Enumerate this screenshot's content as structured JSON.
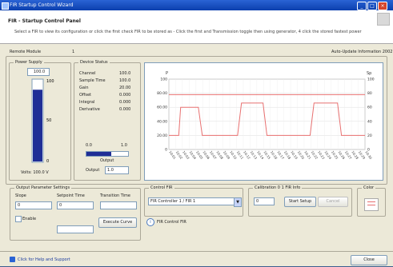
{
  "window": {
    "title": "FIR Startup Control Wizard"
  },
  "header": {
    "title": "FIR - Startup Control Panel",
    "subtitle": "Select a FIR to view its configuration or click the first check FIR to be stored as - Click the first and Transmission toggle then using generator, 4 click the stored fastest power"
  },
  "status": {
    "left_label": "Remote Module",
    "left_value": "1",
    "right_text": "Auto-Update Information 2002"
  },
  "power_supply": {
    "label": "Power Supply",
    "top_value": "100.0",
    "level": 0.88,
    "scale": [
      "100",
      "50",
      "0"
    ],
    "bottom_value": "Volts: 100.0 V"
  },
  "device_info": {
    "label": "Device Status",
    "rows": [
      {
        "name": "Channel",
        "value": "100.0"
      },
      {
        "name": "Sample Time",
        "value": "100.0"
      },
      {
        "name": "Gain",
        "value": "20.00"
      },
      {
        "name": "Offset",
        "value": "0.000"
      },
      {
        "name": "Integral",
        "value": "0.000"
      },
      {
        "name": "Derivative",
        "value": "0.000"
      }
    ],
    "range_min": "0.0",
    "range_max": "1.0",
    "slider_level": 0.6,
    "slider_caption": "Output",
    "output_label": "Output",
    "output_value": "1.0"
  },
  "chart_data": {
    "type": "line",
    "ylabel_left": "P",
    "ylabel_right": "Sp",
    "ylim": [
      0,
      100
    ],
    "y_ticks": [
      "100",
      "80.00",
      "60.00",
      "40.00",
      "20.00",
      "0"
    ],
    "y2_ticks": [
      "100",
      "80",
      "60",
      "40",
      "20",
      "0"
    ],
    "x_ticks": [
      "10:01",
      "10:02",
      "10:03",
      "10:04",
      "10:05",
      "10:06",
      "10:07",
      "10:08",
      "10:09",
      "10:10",
      "10:11",
      "10:12",
      "10:13",
      "10:14",
      "10:15",
      "10:16",
      "10:17",
      "10:18",
      "10:19",
      "10:20",
      "10:21",
      "10:22",
      "10:23",
      "10:24",
      "10:25",
      "10:26",
      "10:27",
      "10:28",
      "10:29",
      "10:30"
    ],
    "series": [
      {
        "color": "#e87070",
        "x": [
          0,
          1
        ],
        "y": [
          78,
          78
        ]
      },
      {
        "color": "#e87070",
        "x": [
          0,
          0.05,
          0.06,
          0.15,
          0.17,
          0.35,
          0.37,
          0.48,
          0.5,
          0.72,
          0.74,
          0.86,
          0.88,
          1
        ],
        "y": [
          20,
          20,
          60,
          60,
          20,
          20,
          66,
          66,
          20,
          20,
          66,
          66,
          20,
          20
        ]
      }
    ],
    "grid": true
  },
  "param_settings": {
    "label": "Output Parameter Settings",
    "col_a": "Slope",
    "col_b": "Setpoint Time",
    "col_c": "Transition Time",
    "val_a": "0",
    "val_b": "0",
    "val_c": "",
    "check_label": "Enable",
    "button": "Execute Curve"
  },
  "control_fir": {
    "label": "Control FIR",
    "selected": "FIR Controller 1 / FIR 1",
    "option_label": "FIR Control FIR"
  },
  "calibration": {
    "label": "Calibration 0 1 FIR Info",
    "field_value": "0",
    "start_button": "Start Setup",
    "stop_button": "Cancel"
  },
  "mini": {
    "label": "Color"
  },
  "footer": {
    "link": "Click for Help and Support",
    "button": "Close"
  }
}
